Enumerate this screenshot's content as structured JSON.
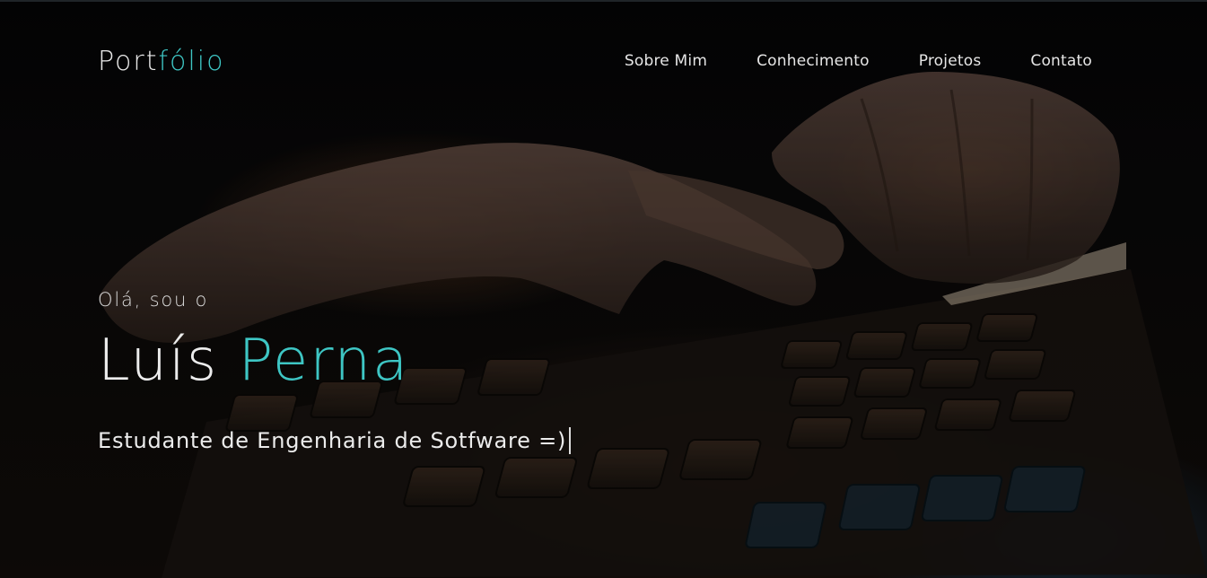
{
  "header": {
    "logo": {
      "part1": "Port",
      "part2": "fólio"
    },
    "nav": [
      {
        "label": "Sobre Mim"
      },
      {
        "label": "Conhecimento"
      },
      {
        "label": "Projetos"
      },
      {
        "label": "Contato"
      }
    ]
  },
  "hero": {
    "greeting": "Olá, sou o",
    "name_first": "Luís",
    "name_last": "Perna",
    "subtitle": "Estudante de Engenharia de Sotfware =)"
  },
  "colors": {
    "accent": "#3ec6c4",
    "text": "#ececec",
    "background": "#0b0b0d"
  }
}
